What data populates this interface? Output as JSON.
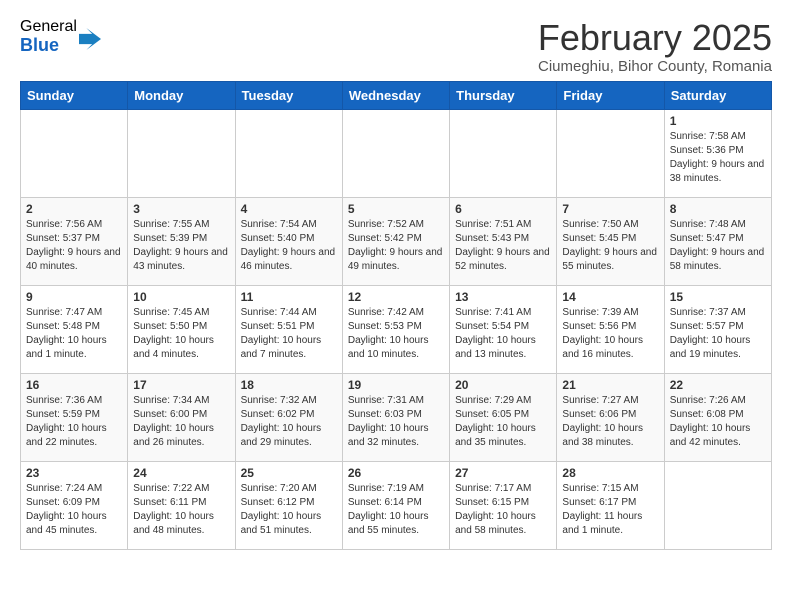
{
  "logo": {
    "general": "General",
    "blue": "Blue"
  },
  "title": "February 2025",
  "subtitle": "Ciumeghiu, Bihor County, Romania",
  "headers": [
    "Sunday",
    "Monday",
    "Tuesday",
    "Wednesday",
    "Thursday",
    "Friday",
    "Saturday"
  ],
  "weeks": [
    [
      {
        "day": "",
        "info": ""
      },
      {
        "day": "",
        "info": ""
      },
      {
        "day": "",
        "info": ""
      },
      {
        "day": "",
        "info": ""
      },
      {
        "day": "",
        "info": ""
      },
      {
        "day": "",
        "info": ""
      },
      {
        "day": "1",
        "info": "Sunrise: 7:58 AM\nSunset: 5:36 PM\nDaylight: 9 hours and 38 minutes."
      }
    ],
    [
      {
        "day": "2",
        "info": "Sunrise: 7:56 AM\nSunset: 5:37 PM\nDaylight: 9 hours and 40 minutes."
      },
      {
        "day": "3",
        "info": "Sunrise: 7:55 AM\nSunset: 5:39 PM\nDaylight: 9 hours and 43 minutes."
      },
      {
        "day": "4",
        "info": "Sunrise: 7:54 AM\nSunset: 5:40 PM\nDaylight: 9 hours and 46 minutes."
      },
      {
        "day": "5",
        "info": "Sunrise: 7:52 AM\nSunset: 5:42 PM\nDaylight: 9 hours and 49 minutes."
      },
      {
        "day": "6",
        "info": "Sunrise: 7:51 AM\nSunset: 5:43 PM\nDaylight: 9 hours and 52 minutes."
      },
      {
        "day": "7",
        "info": "Sunrise: 7:50 AM\nSunset: 5:45 PM\nDaylight: 9 hours and 55 minutes."
      },
      {
        "day": "8",
        "info": "Sunrise: 7:48 AM\nSunset: 5:47 PM\nDaylight: 9 hours and 58 minutes."
      }
    ],
    [
      {
        "day": "9",
        "info": "Sunrise: 7:47 AM\nSunset: 5:48 PM\nDaylight: 10 hours and 1 minute."
      },
      {
        "day": "10",
        "info": "Sunrise: 7:45 AM\nSunset: 5:50 PM\nDaylight: 10 hours and 4 minutes."
      },
      {
        "day": "11",
        "info": "Sunrise: 7:44 AM\nSunset: 5:51 PM\nDaylight: 10 hours and 7 minutes."
      },
      {
        "day": "12",
        "info": "Sunrise: 7:42 AM\nSunset: 5:53 PM\nDaylight: 10 hours and 10 minutes."
      },
      {
        "day": "13",
        "info": "Sunrise: 7:41 AM\nSunset: 5:54 PM\nDaylight: 10 hours and 13 minutes."
      },
      {
        "day": "14",
        "info": "Sunrise: 7:39 AM\nSunset: 5:56 PM\nDaylight: 10 hours and 16 minutes."
      },
      {
        "day": "15",
        "info": "Sunrise: 7:37 AM\nSunset: 5:57 PM\nDaylight: 10 hours and 19 minutes."
      }
    ],
    [
      {
        "day": "16",
        "info": "Sunrise: 7:36 AM\nSunset: 5:59 PM\nDaylight: 10 hours and 22 minutes."
      },
      {
        "day": "17",
        "info": "Sunrise: 7:34 AM\nSunset: 6:00 PM\nDaylight: 10 hours and 26 minutes."
      },
      {
        "day": "18",
        "info": "Sunrise: 7:32 AM\nSunset: 6:02 PM\nDaylight: 10 hours and 29 minutes."
      },
      {
        "day": "19",
        "info": "Sunrise: 7:31 AM\nSunset: 6:03 PM\nDaylight: 10 hours and 32 minutes."
      },
      {
        "day": "20",
        "info": "Sunrise: 7:29 AM\nSunset: 6:05 PM\nDaylight: 10 hours and 35 minutes."
      },
      {
        "day": "21",
        "info": "Sunrise: 7:27 AM\nSunset: 6:06 PM\nDaylight: 10 hours and 38 minutes."
      },
      {
        "day": "22",
        "info": "Sunrise: 7:26 AM\nSunset: 6:08 PM\nDaylight: 10 hours and 42 minutes."
      }
    ],
    [
      {
        "day": "23",
        "info": "Sunrise: 7:24 AM\nSunset: 6:09 PM\nDaylight: 10 hours and 45 minutes."
      },
      {
        "day": "24",
        "info": "Sunrise: 7:22 AM\nSunset: 6:11 PM\nDaylight: 10 hours and 48 minutes."
      },
      {
        "day": "25",
        "info": "Sunrise: 7:20 AM\nSunset: 6:12 PM\nDaylight: 10 hours and 51 minutes."
      },
      {
        "day": "26",
        "info": "Sunrise: 7:19 AM\nSunset: 6:14 PM\nDaylight: 10 hours and 55 minutes."
      },
      {
        "day": "27",
        "info": "Sunrise: 7:17 AM\nSunset: 6:15 PM\nDaylight: 10 hours and 58 minutes."
      },
      {
        "day": "28",
        "info": "Sunrise: 7:15 AM\nSunset: 6:17 PM\nDaylight: 11 hours and 1 minute."
      },
      {
        "day": "",
        "info": ""
      }
    ]
  ]
}
